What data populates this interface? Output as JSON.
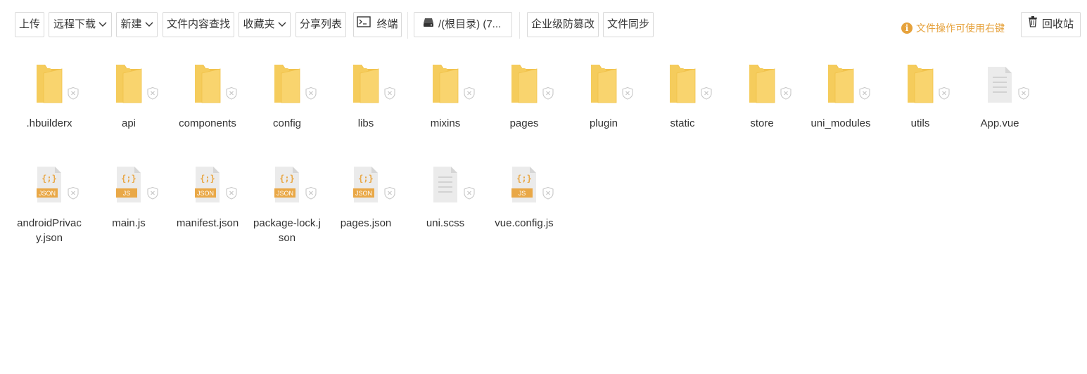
{
  "toolbar": {
    "upload": "上传",
    "remote_download": "远程下载",
    "new": "新建",
    "content_search": "文件内容查找",
    "favorites": "收藏夹",
    "share_list": "分享列表",
    "terminal": "终端",
    "disk": "/(根目录) (7...",
    "tamper_proof": "企业级防篡改",
    "file_sync": "文件同步",
    "hint": "文件操作可使用右键",
    "recycle_bin": "回收站"
  },
  "colors": {
    "folder": "#f9d46e",
    "folder_dark": "#f2c24d",
    "accent": "#e6a23c",
    "doc": "#ebebeb",
    "badge": "#e9a847"
  },
  "files": [
    {
      "name": ".hbuilderx",
      "type": "folder"
    },
    {
      "name": "api",
      "type": "folder"
    },
    {
      "name": "components",
      "type": "folder"
    },
    {
      "name": "config",
      "type": "folder"
    },
    {
      "name": "libs",
      "type": "folder"
    },
    {
      "name": "mixins",
      "type": "folder"
    },
    {
      "name": "pages",
      "type": "folder"
    },
    {
      "name": "plugin",
      "type": "folder"
    },
    {
      "name": "static",
      "type": "folder"
    },
    {
      "name": "store",
      "type": "folder"
    },
    {
      "name": "uni_modules",
      "type": "folder"
    },
    {
      "name": "utils",
      "type": "folder"
    },
    {
      "name": "App.vue",
      "type": "text"
    },
    {
      "name": "androidPrivacy.json",
      "type": "json",
      "badge": "JSON"
    },
    {
      "name": "main.js",
      "type": "js",
      "badge": "JS"
    },
    {
      "name": "manifest.json",
      "type": "json",
      "badge": "JSON"
    },
    {
      "name": "package-lock.json",
      "type": "json",
      "badge": "JSON"
    },
    {
      "name": "pages.json",
      "type": "json",
      "badge": "JSON"
    },
    {
      "name": "uni.scss",
      "type": "text"
    },
    {
      "name": "vue.config.js",
      "type": "js",
      "badge": "JS"
    }
  ]
}
